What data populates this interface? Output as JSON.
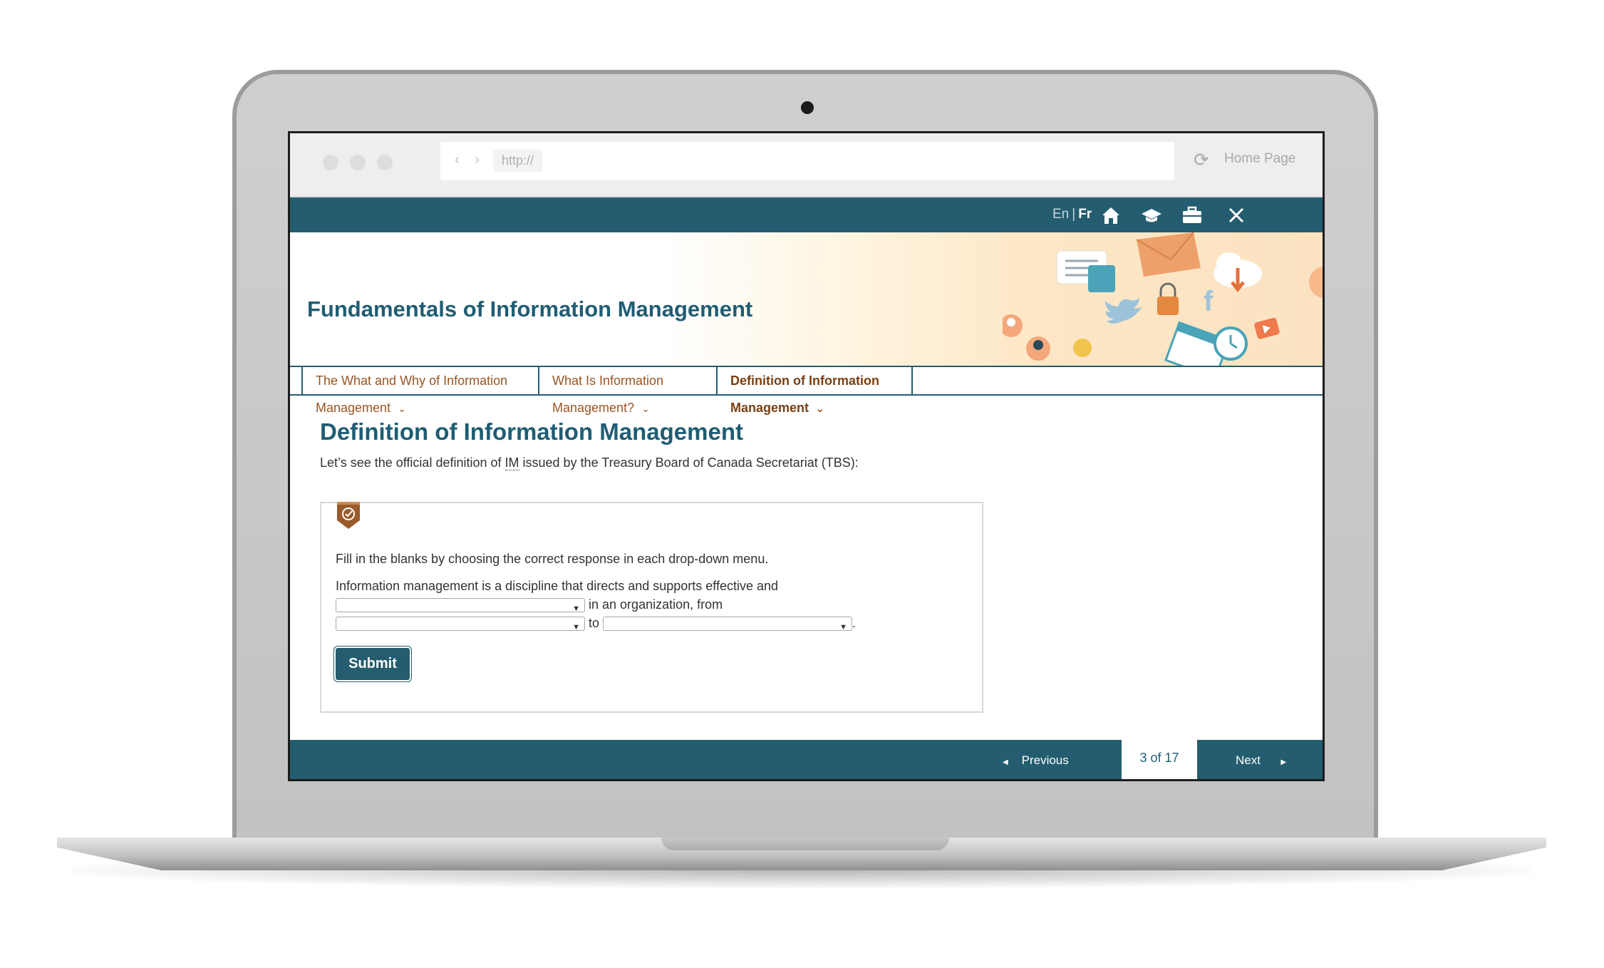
{
  "browser": {
    "url": "http://",
    "nav_arrows": "‹ ›",
    "home_link": "Home Page"
  },
  "topbar": {
    "lang_en": "En",
    "lang_sep": "|",
    "lang_fr": "Fr",
    "icons": [
      "home-icon",
      "graduation-cap-icon",
      "toolbox-icon",
      "close-icon"
    ]
  },
  "course": {
    "title": "Fundamentals of Information Management"
  },
  "tabs": [
    {
      "label": "The What and Why of Information Management"
    },
    {
      "label": "What Is Information Management?"
    },
    {
      "label": "Definition of Information Management"
    }
  ],
  "page": {
    "heading": "Definition of Information Management",
    "intro_before": "Let’s see the official definition of ",
    "intro_abbr": "IM",
    "intro_after": " issued by the Treasury Board of Canada Secretariat (TBS):"
  },
  "activity": {
    "instructions": "Fill in the blanks by choosing the correct response in each drop-down menu.",
    "sentence_start": "Information management is a discipline that directs and supports effective and",
    "after_first": "in an organization, from",
    "between": "to",
    "end": ".",
    "dropdown_1_value": "",
    "dropdown_2_value": "",
    "dropdown_3_value": "",
    "submit_label": "Submit"
  },
  "footer": {
    "previous_label": "Previous",
    "page_indicator": "3 of 17",
    "next_label": "Next"
  },
  "colors": {
    "primary": "#245d6f",
    "accent": "#9a5522"
  }
}
